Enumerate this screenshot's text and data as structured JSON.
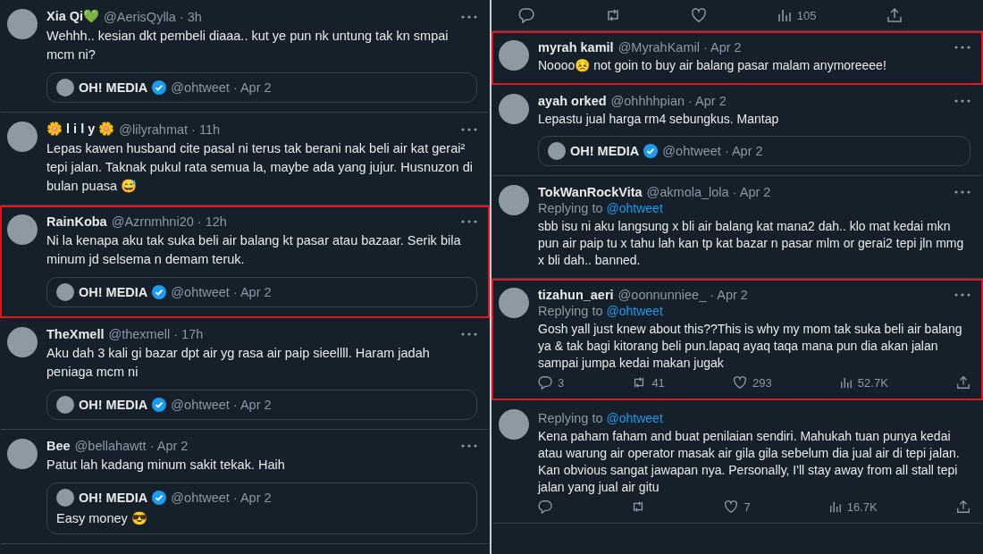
{
  "left_column": [
    {
      "name": "Xia Qi💚",
      "meta": "@AerisQylla · 3h",
      "text": "Wehhh.. kesian dkt pembeli diaaa.. kut ye pun nk untung tak kn smpai mcm ni?",
      "highlighted": false,
      "quote": {
        "name": "OH! MEDIA",
        "verified": true,
        "meta": "@ohtweet · Apr 2"
      }
    },
    {
      "name": "🌼 l i l y 🌼",
      "meta": "@lilyrahmat · 11h",
      "text": "Lepas kawen husband cite pasal ni terus tak berani nak beli air kat gerai² tepi jalan. Taknak pukul rata semua la, maybe ada yang jujur. Husnuzon di bulan puasa 😅",
      "highlighted": false
    },
    {
      "name": "RainKoba",
      "meta": "@Azrnmhni20 · 12h",
      "text": "Ni la kenapa aku tak suka beli air balang kt pasar atau bazaar. Serik bila minum jd selsema n demam teruk.",
      "highlighted": true,
      "quote": {
        "name": "OH! MEDIA",
        "verified": true,
        "meta": "@ohtweet · Apr 2"
      }
    },
    {
      "name": "TheXmell",
      "meta": "@thexmell · 17h",
      "text": "Aku dah 3 kali gi bazar dpt air yg rasa air paip sieellll. Haram jadah peniaga mcm ni",
      "highlighted": false,
      "quote": {
        "name": "OH! MEDIA",
        "verified": true,
        "meta": "@ohtweet · Apr 2"
      }
    },
    {
      "name": "Bee",
      "meta": "@bellahawtt · Apr 2",
      "text": "Patut lah kadang minum sakit tekak. Haih",
      "highlighted": false,
      "quote": {
        "name": "OH! MEDIA",
        "verified": true,
        "meta": "@ohtweet · Apr 2",
        "text": "Easy money 😎"
      }
    }
  ],
  "right_column": {
    "top_actions": [
      {
        "kind": "reply"
      },
      {
        "kind": "retweet"
      },
      {
        "kind": "like"
      },
      {
        "kind": "views",
        "count": "105"
      },
      {
        "kind": "share"
      }
    ],
    "tweets": [
      {
        "name": "myrah kamil",
        "meta": "@MyrahKamil · Apr 2",
        "text": "Noooo😣 not goin to buy air balang pasar malam anymoreeee!",
        "highlighted": true
      },
      {
        "name": "ayah orked",
        "meta": "@ohhhhpian · Apr 2",
        "text": "Lepastu jual harga rm4 sebungkus. Mantap",
        "highlighted": false,
        "quote": {
          "name": "OH! MEDIA",
          "verified": true,
          "meta": "@ohtweet · Apr 2"
        }
      },
      {
        "name": "TokWanRockVita",
        "meta": "@akmola_lola · Apr 2",
        "replying_label": "Replying to",
        "replying_to": "@ohtweet",
        "text": "sbb isu ni aku langsung x bli air balang kat mana2 dah.. klo mat kedai mkn pun air paip tu x tahu lah kan tp kat bazar n pasar mlm or gerai2 tepi jln mmg x bli dah.. banned.",
        "highlighted": false
      },
      {
        "name": "tizahun_aeri",
        "meta": "@oonnunniee_ · Apr 2",
        "replying_label": "Replying to",
        "replying_to": "@ohtweet",
        "text": "Gosh yall just knew about this??This is why my mom tak suka beli air balang ya & tak bagi kitorang beli pun.lapaq ayaq taqa mana pun dia akan jalan sampai jumpa kedai makan jugak",
        "highlighted": true,
        "actions": [
          {
            "kind": "reply",
            "count": "3"
          },
          {
            "kind": "retweet",
            "count": "41"
          },
          {
            "kind": "like",
            "count": "293"
          },
          {
            "kind": "views",
            "count": "52.7K"
          },
          {
            "kind": "share"
          }
        ]
      },
      {
        "replying_label": "Replying to",
        "replying_to": "@ohtweet",
        "text": "Kena paham faham and buat penilaian sendiri. Mahukah tuan punya kedai atau warung air  operator masak air gila gila sebelum dia jual air di tepi jalan. Kan obvious sangat jawapan nya. Personally, I'll stay away from all stall tepi  jalan yang jual air gitu",
        "highlighted": false,
        "actions": [
          {
            "kind": "reply"
          },
          {
            "kind": "retweet"
          },
          {
            "kind": "like",
            "count": "7"
          },
          {
            "kind": "views",
            "count": "16.7K"
          },
          {
            "kind": "share"
          }
        ]
      }
    ]
  }
}
